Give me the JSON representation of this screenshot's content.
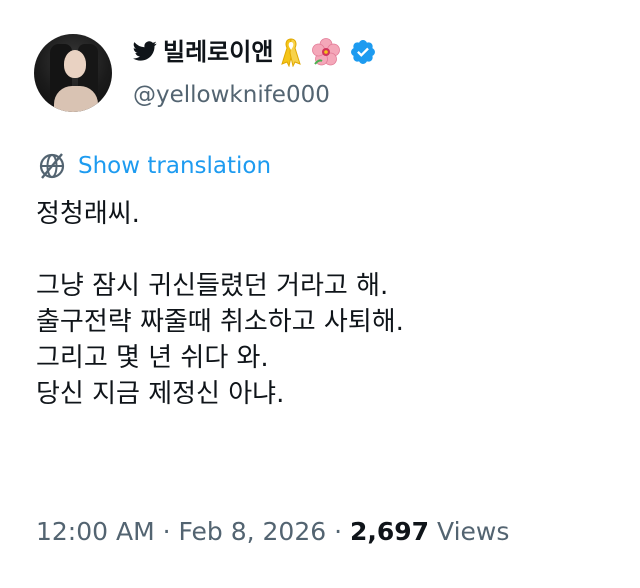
{
  "author": {
    "display_name": "빌레로이앤",
    "handle": "@yellowknife000",
    "icons": [
      "bird-icon",
      "yellow-ribbon-icon",
      "hibiscus-flower-icon",
      "verified-badge-icon"
    ],
    "verified_color": "#1d9bf0"
  },
  "translation": {
    "label": "Show translation",
    "color": "#1d9bf0"
  },
  "tweet": {
    "lines": [
      "정청래씨.",
      "",
      "그냥 잠시 귀신들렸던 거라고 해.",
      "출구전략 짜줄때 취소하고 사퇴해.",
      "그리고 몇 년 쉬다 와.",
      "당신 지금 제정신 아냐."
    ]
  },
  "meta": {
    "time": "12:00 AM",
    "date": "Feb 8, 2026",
    "separator": " · ",
    "views_count": "2,697",
    "views_label": "Views"
  }
}
